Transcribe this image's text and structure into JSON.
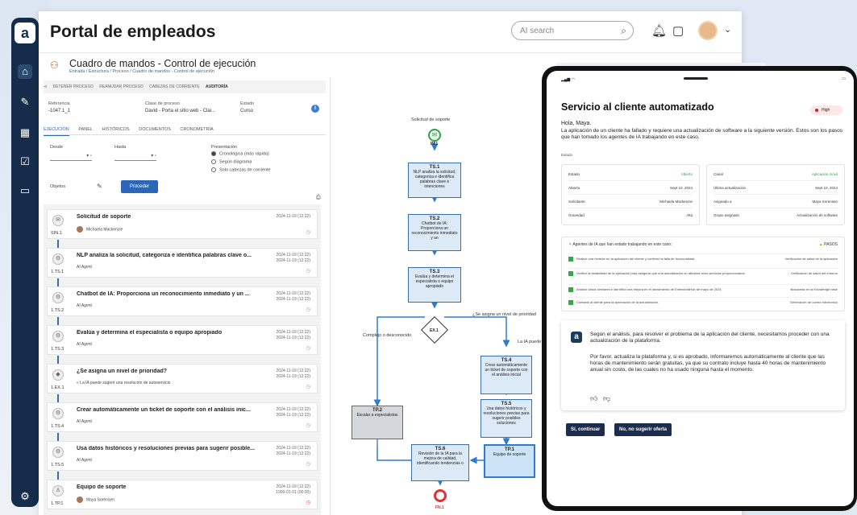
{
  "nav": {
    "logo": "a",
    "icons": [
      "home-icon",
      "edit-icon",
      "calendar-icon",
      "calendar-check-icon",
      "briefcase-icon",
      "settings-icon"
    ]
  },
  "header": {
    "title": "Portal de empleados",
    "search_placeholder": "AI search"
  },
  "breadcrumb": {
    "title": "Cuadro de mandos - Control de ejecución",
    "path": "Entrada / Estructura / Proceso / Cuadro de mandos - Control de ejecución"
  },
  "toolbar": [
    "DETENER PROCESO",
    "REANUDAR PROCESO",
    "CABEZAS DE CORRIENTE",
    "AUDITORÍA"
  ],
  "meta": {
    "ref_label": "Referencia",
    "ref_value": "-1047.1_1",
    "class_label": "Clase de proceso",
    "class_value": "David - Porta el sitio web - Clai...",
    "state_label": "Estado",
    "state_value": "Curso"
  },
  "tabs": [
    "EJECUCIÓN",
    "PANEL",
    "HISTÓRICOS",
    "DOCUMENTOS",
    "CRONOMETRÍA"
  ],
  "filters": {
    "desde": "Desde",
    "hasta": "Hasta",
    "presentacion": "Presentación",
    "radios": [
      "Cronológica (más rápida)",
      "Según diagrama",
      "Solo cabezas de corriente"
    ],
    "objetos": "Objetos",
    "proceder": "Proceder"
  },
  "tasks": [
    {
      "code": "SIN.1",
      "title": "Solicitud de soporte",
      "who": "Michaela Mackenzie",
      "d1": "2024-11-19 (12:22)",
      "d2": ""
    },
    {
      "code": "1.TS.1",
      "title": "NLP analiza la solicitud, categoriza e identifica palabras clave o...",
      "who": "AI Agent",
      "d1": "2024-11-19 (12:22)",
      "d2": "2024-11-19 (12:22)"
    },
    {
      "code": "1.TS.2",
      "title": "Chatbot de IA: Proporciona un reconocimiento inmediato y un ...",
      "who": "AI Agent",
      "d1": "2024-11-19 (12:22)",
      "d2": "2024-11-19 (12:22)"
    },
    {
      "code": "1.TS.3",
      "title": "Evalúa y determina el especialista o equipo apropiado",
      "who": "AI Agent",
      "d1": "2024-11-19 (12:22)",
      "d2": "2024-11-19 (12:22)"
    },
    {
      "code": "1.EX.1",
      "title": "¿Se asigna un nivel de prioridad?",
      "who": "« La IA puede sugerir una resolución de autoservicio",
      "d1": "2024-11-19 (12:22)",
      "d2": "2024-11-19 (12:22)"
    },
    {
      "code": "1.TS.4",
      "title": "Crear automáticamente un ticket de soporte con el análisis inic...",
      "who": "AI Agent",
      "d1": "2024-11-19 (12:22)",
      "d2": "2024-11-19 (12:22)"
    },
    {
      "code": "1.TS.5",
      "title": "Usa datos históricos y resoluciones previas para sugerir posible...",
      "who": "AI Agent",
      "d1": "2024-11-19 (12:22)",
      "d2": "2024-11-19 (12:22)"
    },
    {
      "code": "1.TP.1",
      "title": "Equipo de soporte",
      "who": "Maya Sorensen",
      "d1": "2024-11-19 (12:22)",
      "d2": "1900-01-01 (00:00)"
    }
  ],
  "diagram": {
    "start": "Solicitud de soporte",
    "start_code": "IN.1",
    "ts1": {
      "code": "TS.1",
      "text": "NLP analiza la solicitud, categoriza e identifica palabras clave e intenciones"
    },
    "ts2": {
      "code": "TS.2",
      "text": "Chatbot de IA: Proporciona un reconocimiento inmediato y un"
    },
    "ts3": {
      "code": "TS.3",
      "text": "Evalúa y determina el especialista o equipo apropiado"
    },
    "ex1": "EX.1",
    "lbl_prio": "¿Se asigna un nivel de prioridad",
    "lbl_complejo": "Complejo o desconocido",
    "lbl_ia": "La IA puede",
    "ts4": {
      "code": "TS.4",
      "text": "Crear automáticamente un ticket de soporte con el análisis inicial"
    },
    "ts5": {
      "code": "TS.5",
      "text": "Usa datos históricos y resoluciones previas para sugerir posibles soluciones"
    },
    "tp2": {
      "code": "TP.2",
      "text": "Escalar a especialistas"
    },
    "ts6": {
      "code": "TS.6",
      "text": "Revisión de la IA para la mejora de calidad, identificando tendencias o"
    },
    "tp1": {
      "code": "TP.1",
      "text": "Equipo de soporte"
    },
    "end_code": "FN.1"
  },
  "tablet": {
    "title": "Servicio al cliente automatizado",
    "priority": "High",
    "greeting": "Hola, Maya.",
    "intro": "La aplicación de un cliente ha fallado y requiere una actualización de software a la siguiente versión. Estos son los pasos que han tomado los agentes de IA trabajando en este caso.",
    "estado_label": "Estado",
    "left_kv": [
      [
        "Estado",
        "Abierto"
      ],
      [
        "Abierto",
        "Sept 10, 2024"
      ],
      [
        "Solicitante",
        "Michaela Mackenzie"
      ],
      [
        "Gravedad",
        "Alta"
      ]
    ],
    "right_kv": [
      [
        "Canal",
        "Aplicación móvil"
      ],
      [
        "Última actualización",
        "Sept 10, 2024"
      ],
      [
        "Asignado a",
        "Maya Sorensen"
      ],
      [
        "Grupo asignado",
        "Actualización de software"
      ]
    ],
    "agents_title": "Agentes de IA que han estado trabajando en este caso:",
    "agents_count": "PASOS",
    "agents": [
      [
        "Realizó una revisión en la aplicación del cliente y confirmó la falla de funcionalidad.",
        "Verificación de salud de la aplicación"
      ],
      [
        "Verificó la estabilidad de la aplicación para asegurar que una actualización no afectará otros servicios proporcionados.",
        "Verificación de salud del entorno"
      ],
      [
        "Analizó casos similares e identificó una mejora en el lanzamiento de ExtendoraHub de mayo de 2024",
        "Búsqueda en la Knowledge base"
      ],
      [
        "Contactó al cliente para la aprobación de la actualización.",
        "Generación de correo electrónico"
      ]
    ],
    "chat_p1": "Según el análisis, para resolver el problema de la aplicación del cliente, necesitamos proceder con una actualización de la plataforma.",
    "chat_p2": "Por favor, actualiza la plataforma y, si es aprobado, informaremos automáticamente al cliente que las horas de mantenimiento serán gratuitas, ya que su contrato incluye hasta 40 horas de mantenimiento anual sin costo, de las cuales no ha usado ninguna hasta el momento.",
    "btn_yes": "Sí, continuar",
    "btn_no": "No, no sugerir oferta"
  }
}
